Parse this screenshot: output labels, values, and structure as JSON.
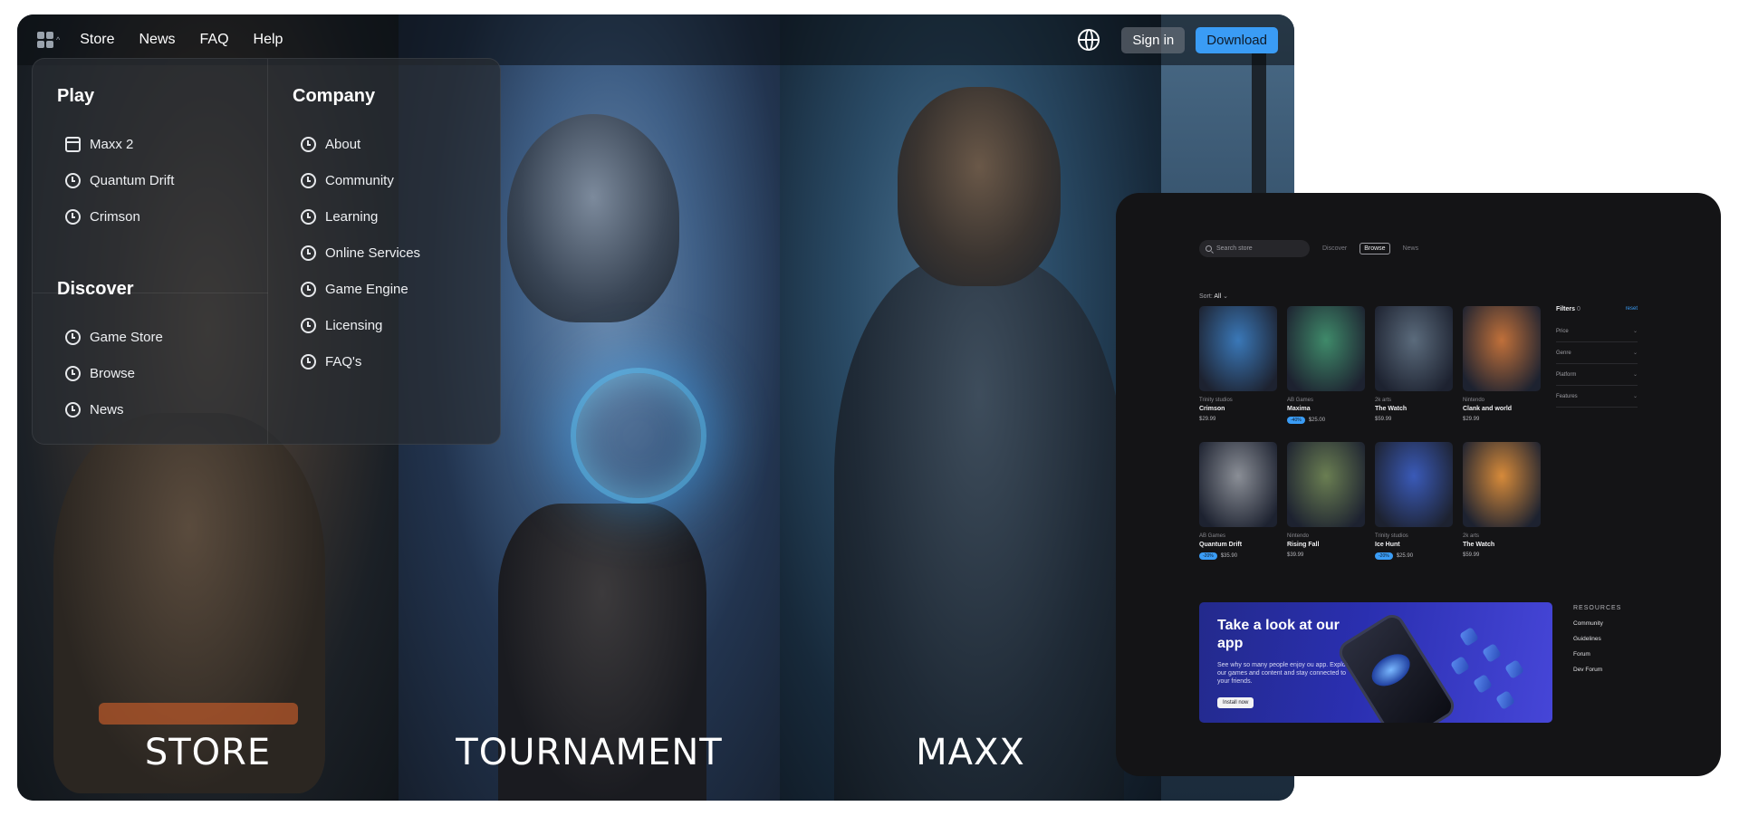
{
  "nav": {
    "links": [
      "Store",
      "News",
      "FAQ",
      "Help"
    ],
    "sign_in": "Sign in",
    "download": "Download"
  },
  "menu": {
    "play": {
      "heading": "Play",
      "items": [
        "Maxx 2",
        "Quantum Drift",
        "Crimson"
      ]
    },
    "discover": {
      "heading": "Discover",
      "items": [
        "Game Store",
        "Browse",
        "News"
      ]
    },
    "company": {
      "heading": "Company",
      "items": [
        "About",
        "Community",
        "Learning",
        "Online Services",
        "Game Engine",
        "Licensing",
        "FAQ's"
      ]
    }
  },
  "hero": {
    "labels": [
      "STORE",
      "TOURNAMENT",
      "MAXX"
    ]
  },
  "store": {
    "search_placeholder": "Search store",
    "tabs": [
      "Discover",
      "Browse",
      "News"
    ],
    "active_tab": "Browse",
    "sort_label": "Sort:",
    "sort_value": "All",
    "games": [
      {
        "publisher": "Trinity studios",
        "title": "Crimson",
        "discount": "",
        "price": "$29.99",
        "color": "#3a78b8"
      },
      {
        "publisher": "AB Games",
        "title": "Maxima",
        "discount": "-40%",
        "price": "$25.00",
        "color": "#3f8a6a"
      },
      {
        "publisher": "2k arts",
        "title": "The Watch",
        "discount": "",
        "price": "$59.99",
        "color": "#5b6b7c"
      },
      {
        "publisher": "Nintendo",
        "title": "Clank and world",
        "discount": "",
        "price": "$29.99",
        "color": "#c0703a"
      },
      {
        "publisher": "AB Games",
        "title": "Quantum Drift",
        "discount": "-20%",
        "price": "$35.90",
        "color": "#8a8e96"
      },
      {
        "publisher": "Nintendo",
        "title": "Rising Fall",
        "discount": "",
        "price": "$39.99",
        "color": "#6a7e52"
      },
      {
        "publisher": "Trinity studios",
        "title": "Ice Hunt",
        "discount": "-20%",
        "price": "$25.90",
        "color": "#3a5ab8"
      },
      {
        "publisher": "2k arts",
        "title": "The Watch",
        "discount": "",
        "price": "$59.99",
        "color": "#d68a3a"
      }
    ],
    "filters": {
      "title": "Filters",
      "count": "0",
      "reset": "reset",
      "groups": [
        "Price",
        "Genre",
        "Platform",
        "Features"
      ]
    },
    "promo": {
      "title": "Take a look at our app",
      "body": "See why so many people enjoy ou app. Explor our games and content and stay connected to your friends.",
      "button": "Install now"
    },
    "resources": {
      "heading": "RESOURCES",
      "links": [
        "Community",
        "Guidelines",
        "Forum",
        "Dev Forum"
      ]
    }
  }
}
